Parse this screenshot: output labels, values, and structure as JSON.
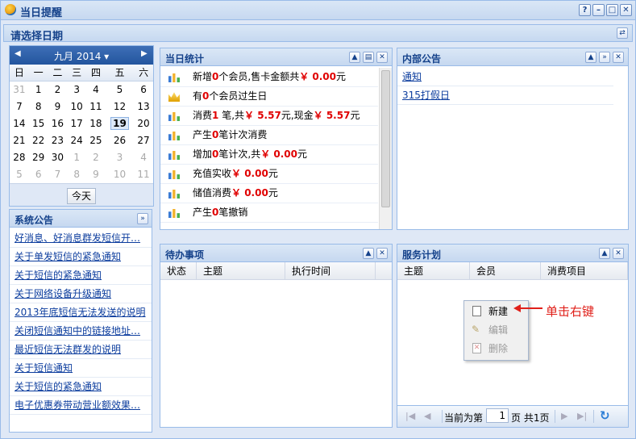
{
  "window": {
    "title": "当日提醒"
  },
  "date_section": {
    "title": "请选择日期"
  },
  "calendar": {
    "month_label": "九月 2014",
    "weekdays": [
      "日",
      "一",
      "二",
      "三",
      "四",
      "五",
      "六"
    ],
    "today_button": "今天",
    "rows": [
      [
        "31",
        "1",
        "2",
        "3",
        "4",
        "5",
        "6"
      ],
      [
        "7",
        "8",
        "9",
        "10",
        "11",
        "12",
        "13"
      ],
      [
        "14",
        "15",
        "16",
        "17",
        "18",
        "19",
        "20"
      ],
      [
        "21",
        "22",
        "23",
        "24",
        "25",
        "26",
        "27"
      ],
      [
        "28",
        "29",
        "30",
        "1",
        "2",
        "3",
        "4"
      ],
      [
        "5",
        "6",
        "7",
        "8",
        "9",
        "10",
        "11"
      ]
    ],
    "selected_day": "19"
  },
  "system_notice": {
    "title": "系统公告",
    "items": [
      "好消息、好消息群发短信开…",
      "关于单发短信的紧急通知",
      "关于短信的紧急通知",
      "关于网络设备升级通知",
      "2013年底短信无法发送的说明",
      "关闭短信通知中的链接地址…",
      "最近短信无法群发的说明",
      "关于短信通知",
      "关于短信的紧急通知",
      "电子优惠券带动营业额效果…"
    ]
  },
  "daily_stats": {
    "title": "当日统计",
    "rows": [
      {
        "a": "新增",
        "b": "0",
        "c": "个会员,售卡金额共",
        "d": "￥ 0.00",
        "e": "元",
        "f": "",
        "g": "",
        "h": ""
      },
      {
        "a": "有",
        "b": "0",
        "c": "个会员过生日",
        "d": "",
        "e": "",
        "f": "",
        "g": "",
        "h": ""
      },
      {
        "a": "消费",
        "b": "1",
        "c": " 笔,共",
        "d": "￥ 5.57",
        "e": "元,现金",
        "f": "￥ 5.57",
        "g": "元",
        "h": ""
      },
      {
        "a": "产生",
        "b": "0",
        "c": "笔计次消费",
        "d": "",
        "e": "",
        "f": "",
        "g": "",
        "h": ""
      },
      {
        "a": "增加",
        "b": "0",
        "c": "笔计次,共",
        "d": "￥ 0.00",
        "e": "元",
        "f": "",
        "g": "",
        "h": ""
      },
      {
        "a": "充值实收",
        "b": "",
        "c": "",
        "d": "￥ 0.00",
        "e": "元",
        "f": "",
        "g": "",
        "h": ""
      },
      {
        "a": "储值消费",
        "b": "",
        "c": "",
        "d": "￥ 0.00",
        "e": "元",
        "f": "",
        "g": "",
        "h": ""
      },
      {
        "a": "产生",
        "b": "0",
        "c": "笔撤销",
        "d": "",
        "e": "",
        "f": "",
        "g": "",
        "h": ""
      }
    ]
  },
  "internal_notice": {
    "title": "内部公告",
    "items": [
      "通知",
      "315打假日"
    ]
  },
  "todo": {
    "title": "待办事项",
    "columns": [
      "状态",
      "主题",
      "执行时间"
    ]
  },
  "service_plan": {
    "title": "服务计划",
    "columns": [
      "主题",
      "会员",
      "消费项目"
    ],
    "pager": {
      "before": "当前为第",
      "page": "1",
      "after": "页 共1页"
    }
  },
  "context_menu": {
    "items": [
      "新建",
      "编辑",
      "删除"
    ]
  },
  "annotation": {
    "text": "单击右键"
  },
  "colors": {
    "accent": "#15428b",
    "header_bg": "#c6d8f0",
    "value_red": "#e00000",
    "annotation_red": "#e0201a"
  }
}
